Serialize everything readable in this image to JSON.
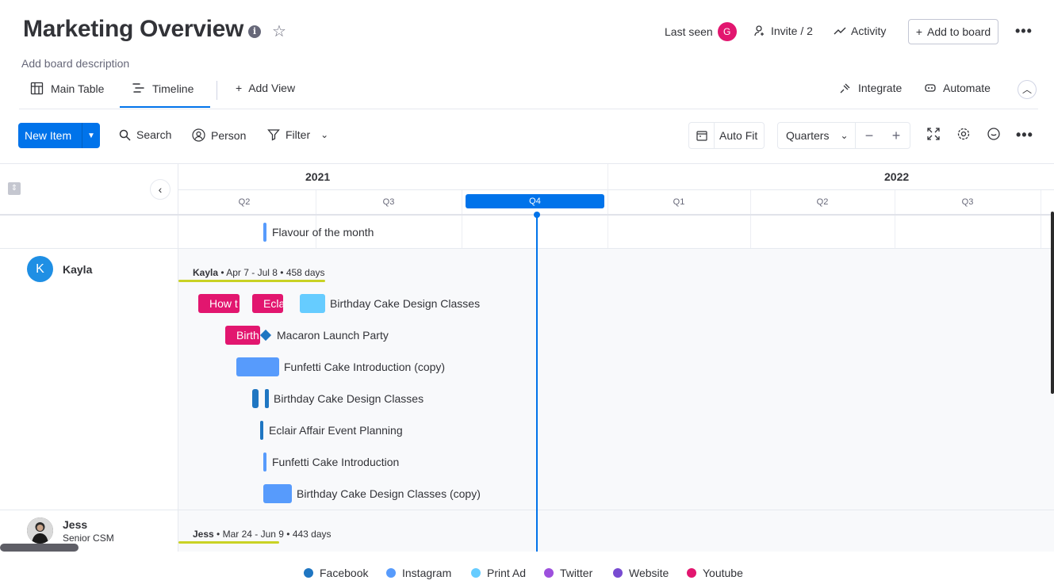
{
  "board": {
    "title": "Marketing Overview",
    "description": "Add board description",
    "last_seen_label": "Last seen",
    "last_seen_avatar": "G",
    "invite_label": "Invite / 2",
    "activity_label": "Activity",
    "add_to_board_label": "Add to board"
  },
  "views": {
    "main_table": "Main Table",
    "timeline": "Timeline",
    "add_view": "Add View",
    "integrate": "Integrate",
    "automate": "Automate"
  },
  "toolbar": {
    "new_item": "New Item",
    "search": "Search",
    "person": "Person",
    "filter": "Filter",
    "auto_fit": "Auto Fit",
    "zoom": "Quarters"
  },
  "timeline": {
    "years": [
      "2021",
      "2022"
    ],
    "quarters": [
      "Q2",
      "Q3",
      "Q4",
      "Q1",
      "Q2",
      "Q3"
    ],
    "ungrouped_item": "Flavour of the month",
    "groups": [
      {
        "name": "Kayla",
        "avatar": "K",
        "summary_name": "Kayla",
        "summary_range": "Apr 7 - Jul 8",
        "summary_days": "458 days",
        "items": [
          {
            "label": "Birthday Cake Design Classes",
            "bars": [
              "How t",
              "Ecla"
            ]
          },
          {
            "label": "Macaron Launch Party",
            "bars": [
              "Birth"
            ]
          },
          {
            "label": "Funfetti Cake Introduction (copy)"
          },
          {
            "label": "Birthday Cake Design Classes"
          },
          {
            "label": "Eclair Affair Event Planning"
          },
          {
            "label": "Funfetti Cake Introduction"
          },
          {
            "label": "Birthday Cake Design Classes (copy)"
          }
        ]
      },
      {
        "name": "Jess",
        "role": "Senior CSM",
        "summary_name": "Jess",
        "summary_range": "Mar 24 - Jun 9",
        "summary_days": "443 days"
      }
    ]
  },
  "legend": [
    {
      "label": "Facebook",
      "color": "#1f76c2"
    },
    {
      "label": "Instagram",
      "color": "#579bfc"
    },
    {
      "label": "Print Ad",
      "color": "#66ccff"
    },
    {
      "label": "Twitter",
      "color": "#9d50dd"
    },
    {
      "label": "Website",
      "color": "#784bd1"
    },
    {
      "label": "Youtube",
      "color": "#e2166f"
    }
  ]
}
